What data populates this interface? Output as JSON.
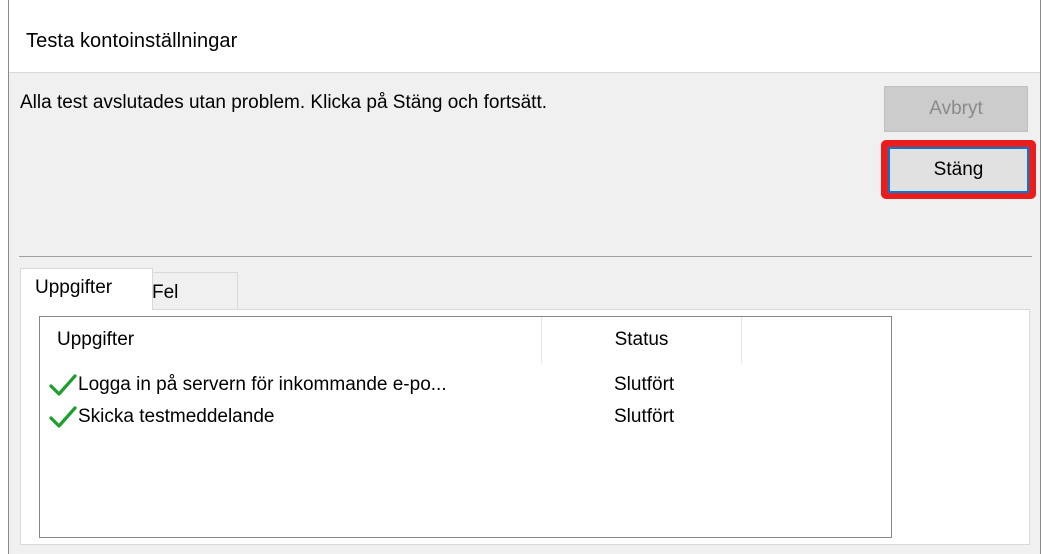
{
  "dialog": {
    "title": "Testa kontoinställningar",
    "message": "Alla test avslutades utan problem. Klicka på Stäng och fortsätt.",
    "buttons": {
      "cancel": "Avbryt",
      "close": "Stäng"
    }
  },
  "tabs": [
    {
      "label": "Uppgifter",
      "selected": true
    },
    {
      "label": "Fel",
      "selected": false
    }
  ],
  "table": {
    "columns": [
      "Uppgifter",
      "Status"
    ],
    "rows": [
      {
        "task": "Logga in på servern för inkommande e-po...",
        "status": "Slutfört",
        "icon": "checkmark-icon"
      },
      {
        "task": "Skicka testmeddelande",
        "status": "Slutfört",
        "icon": "checkmark-icon"
      }
    ]
  },
  "colors": {
    "highlight": "#ea1c1c",
    "focus_border": "#0078d7",
    "check": "#1e9e2c"
  }
}
